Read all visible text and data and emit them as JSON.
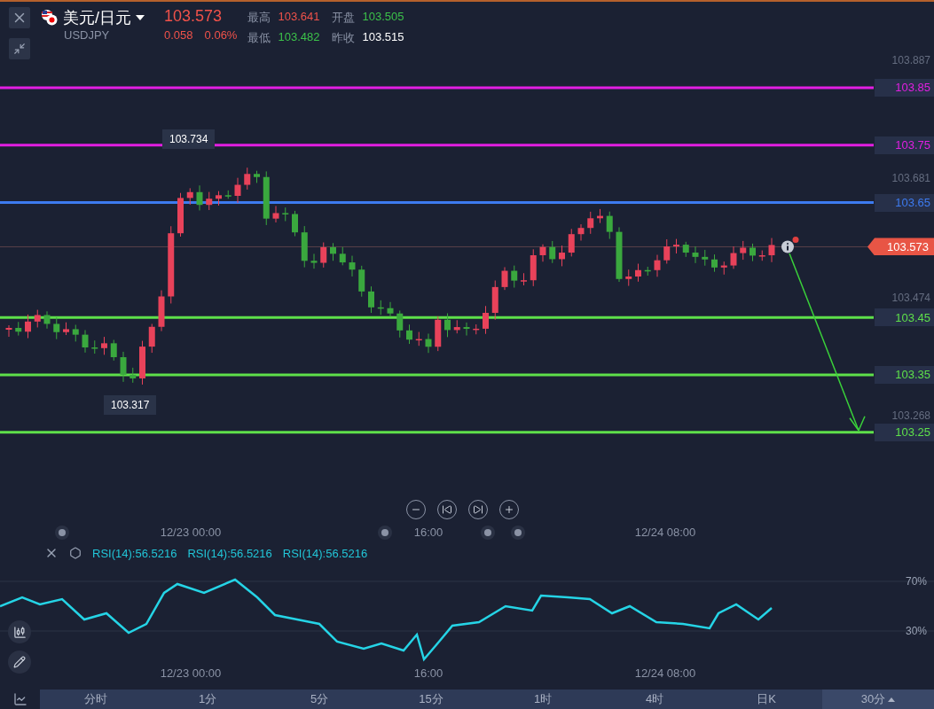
{
  "header": {
    "pair": "美元/日元",
    "symbol": "USDJPY",
    "price": "103.573",
    "change": "0.058",
    "change_pct": "0.06%",
    "stats": [
      {
        "label": "最高",
        "value": "103.641",
        "color": "#f0524a"
      },
      {
        "label": "开盘",
        "value": "103.505",
        "color": "#3cc24a"
      },
      {
        "label": "最低",
        "value": "103.482",
        "color": "#3cc24a"
      },
      {
        "label": "昨收",
        "value": "103.515",
        "color": "#ffffff"
      }
    ]
  },
  "price_axis": {
    "ticks": [
      "103.887",
      "103.681",
      "103.474",
      "103.268"
    ]
  },
  "level_lines": [
    {
      "label": "103.85",
      "color": "#e21ee2"
    },
    {
      "label": "103.75",
      "color": "#e21ee2"
    },
    {
      "label": "103.65",
      "color": "#3d7bf0"
    },
    {
      "label": "103.45",
      "color": "#5ee04a"
    },
    {
      "label": "103.35",
      "color": "#5ee04a"
    },
    {
      "label": "103.25",
      "color": "#5ee04a"
    }
  ],
  "current_price": "103.573",
  "callouts": [
    {
      "kind": "high",
      "label": "103.734"
    },
    {
      "kind": "low",
      "label": "103.317"
    }
  ],
  "nav_buttons": [
    {
      "kind": "zoom-out"
    },
    {
      "kind": "first"
    },
    {
      "kind": "last"
    },
    {
      "kind": "zoom-in"
    }
  ],
  "time_axis": [
    "12/23 00:00",
    "16:00",
    "12/24 08:00"
  ],
  "rsi": {
    "labels": [
      "RSI(14):56.5216",
      "RSI(14):56.5216",
      "RSI(14):56.5216"
    ],
    "ticks": [
      "70%",
      "30%"
    ],
    "time_axis": [
      "12/23 00:00",
      "16:00",
      "12/24 08:00"
    ]
  },
  "periods": [
    {
      "label": "分时",
      "selected": false
    },
    {
      "label": "1分",
      "selected": false
    },
    {
      "label": "5分",
      "selected": false
    },
    {
      "label": "15分",
      "selected": false
    },
    {
      "label": "1时",
      "selected": false
    },
    {
      "label": "4时",
      "selected": false
    },
    {
      "label": "日K",
      "selected": false
    },
    {
      "label": "30分",
      "selected": true
    }
  ]
}
